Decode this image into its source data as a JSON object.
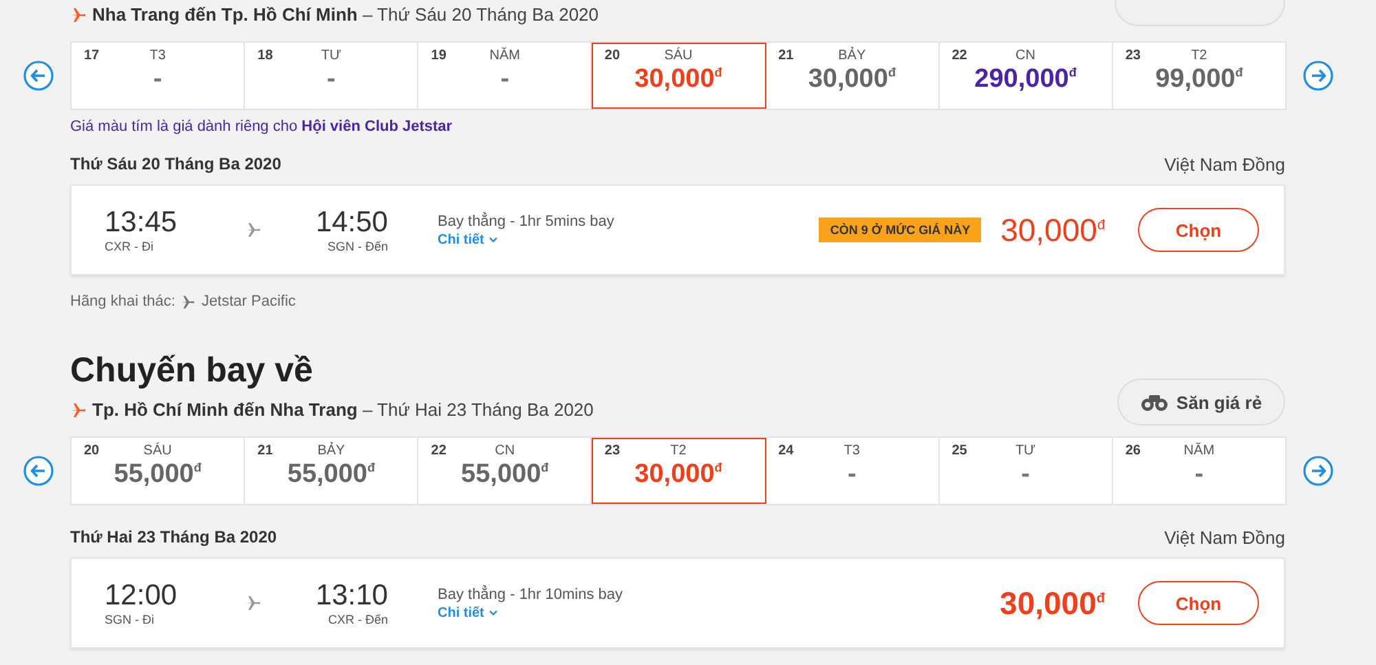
{
  "sections": [
    {
      "has_hunt_button": true,
      "route": "Nha Trang đến Tp. Hồ Chí Minh",
      "route_date": "– Thứ Sáu 20 Tháng Ba 2020",
      "dates": [
        {
          "day": "17",
          "weekday": "T3",
          "price": "-",
          "kind": "none",
          "selected": false
        },
        {
          "day": "18",
          "weekday": "TƯ",
          "price": "-",
          "kind": "none",
          "selected": false
        },
        {
          "day": "19",
          "weekday": "NĂM",
          "price": "-",
          "kind": "none",
          "selected": false
        },
        {
          "day": "20",
          "weekday": "SÁU",
          "price": "30,000",
          "currency": "đ",
          "kind": "normal",
          "selected": true
        },
        {
          "day": "21",
          "weekday": "BẢY",
          "price": "30,000",
          "currency": "đ",
          "kind": "normal",
          "selected": false
        },
        {
          "day": "22",
          "weekday": "CN",
          "price": "290,000",
          "currency": "đ",
          "kind": "member",
          "selected": false
        },
        {
          "day": "23",
          "weekday": "T2",
          "price": "99,000",
          "currency": "đ",
          "kind": "normal",
          "selected": false
        }
      ],
      "note": "Giá màu tím là giá dành riêng cho **Hội viên Club Jetstar**",
      "date_heading": "Thứ Sáu 20 Tháng Ba 2020",
      "currency_name": "Việt Nam Đồng",
      "flight": {
        "depart_time": "13:45",
        "depart_label": "CXR - Đi",
        "arrive_time": "14:50",
        "arrive_label": "SGN - Đến",
        "info": "Bay thẳng - 1hr 5mins bay",
        "details": "Chi tiết",
        "badge": "CÒN 9 Ở MỨC GIÁ NÀY",
        "price": "30,000",
        "currency": "đ",
        "bold": false,
        "button": "Chọn"
      },
      "operator_label": "Hãng khai thác:",
      "operator": "Jetstar Pacific"
    },
    {
      "heading": "Chuyến bay về",
      "hunt_button": "Săn giá rẻ",
      "route": "Tp. Hồ Chí Minh đến Nha Trang",
      "route_date": "– Thứ Hai 23 Tháng Ba 2020",
      "dates": [
        {
          "day": "20",
          "weekday": "SÁU",
          "price": "55,000",
          "currency": "đ",
          "kind": "normal",
          "selected": false
        },
        {
          "day": "21",
          "weekday": "BẢY",
          "price": "55,000",
          "currency": "đ",
          "kind": "normal",
          "selected": false
        },
        {
          "day": "22",
          "weekday": "CN",
          "price": "55,000",
          "currency": "đ",
          "kind": "normal",
          "selected": false
        },
        {
          "day": "23",
          "weekday": "T2",
          "price": "30,000",
          "currency": "đ",
          "kind": "normal",
          "selected": true
        },
        {
          "day": "24",
          "weekday": "T3",
          "price": "-",
          "kind": "none",
          "selected": false
        },
        {
          "day": "25",
          "weekday": "TƯ",
          "price": "-",
          "kind": "none",
          "selected": false
        },
        {
          "day": "26",
          "weekday": "NĂM",
          "price": "-",
          "kind": "none",
          "selected": false
        }
      ],
      "date_heading": "Thứ Hai 23 Tháng Ba 2020",
      "currency_name": "Việt Nam Đồng",
      "flight": {
        "depart_time": "12:00",
        "depart_label": "SGN - Đi",
        "arrive_time": "13:10",
        "arrive_label": "CXR - Đến",
        "info": "Bay thẳng - 1hr 10mins bay",
        "details": "Chi tiết",
        "price": "30,000",
        "currency": "đ",
        "bold": true,
        "button": "Chọn"
      }
    }
  ]
}
